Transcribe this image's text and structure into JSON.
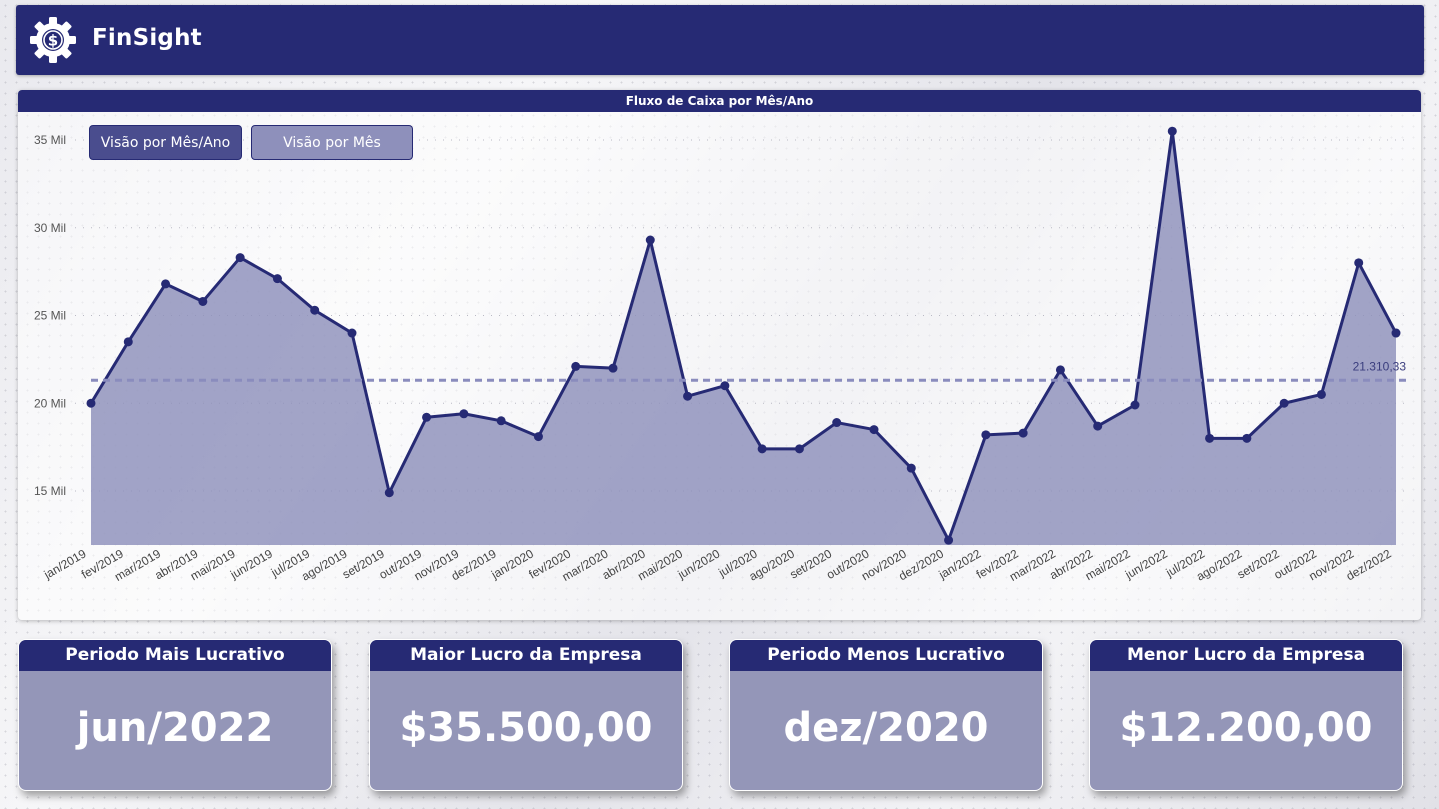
{
  "app": {
    "brand": "FinSight"
  },
  "chart_title": "Fluxo de Caixa por Mês/Ano",
  "toggles": {
    "by_month_year": "Visão por Mês/Ano",
    "by_month": "Visão por Mês"
  },
  "colors": {
    "primary": "#262a74",
    "area": "#8e90bb",
    "line": "#262a74",
    "avg_line": "#8a8cbd"
  },
  "kpis": [
    {
      "title": "Periodo Mais Lucrativo",
      "value": "jun/2022"
    },
    {
      "title": "Maior Lucro da Empresa",
      "value": "$35.500,00"
    },
    {
      "title": "Periodo Menos Lucrativo",
      "value": "dez/2020"
    },
    {
      "title": "Menor Lucro da Empresa",
      "value": "$12.200,00"
    }
  ],
  "chart_data": {
    "type": "area",
    "title": "Fluxo de Caixa por Mês/Ano",
    "xlabel": "",
    "ylabel": "",
    "ylim": [
      12000,
      36000
    ],
    "yticks": [
      15000,
      20000,
      25000,
      30000,
      35000
    ],
    "ytick_labels": [
      "15 Mil",
      "20 Mil",
      "25 Mil",
      "30 Mil",
      "35 Mil"
    ],
    "grid": true,
    "categories": [
      "jan/2019",
      "fev/2019",
      "mar/2019",
      "abr/2019",
      "mai/2019",
      "jun/2019",
      "jul/2019",
      "ago/2019",
      "set/2019",
      "out/2019",
      "nov/2019",
      "dez/2019",
      "jan/2020",
      "fev/2020",
      "mar/2020",
      "abr/2020",
      "mai/2020",
      "jun/2020",
      "jul/2020",
      "ago/2020",
      "set/2020",
      "out/2020",
      "nov/2020",
      "dez/2020",
      "jan/2022",
      "fev/2022",
      "mar/2022",
      "abr/2022",
      "mai/2022",
      "jun/2022",
      "jul/2022",
      "ago/2022",
      "set/2022",
      "out/2022",
      "nov/2022",
      "dez/2022"
    ],
    "series": [
      {
        "values": [
          20000,
          23500,
          26800,
          25800,
          28300,
          27100,
          25300,
          24000,
          14900,
          19200,
          19400,
          19000,
          18100,
          22100,
          22000,
          29300,
          20400,
          21000,
          17400,
          17400,
          18900,
          18500,
          16300,
          12200,
          18200,
          18300,
          21900,
          18700,
          19900,
          35500,
          18000,
          18000,
          20000,
          20500,
          28000,
          24000
        ]
      }
    ],
    "average": 21310.33,
    "average_label": "21.310,33"
  }
}
